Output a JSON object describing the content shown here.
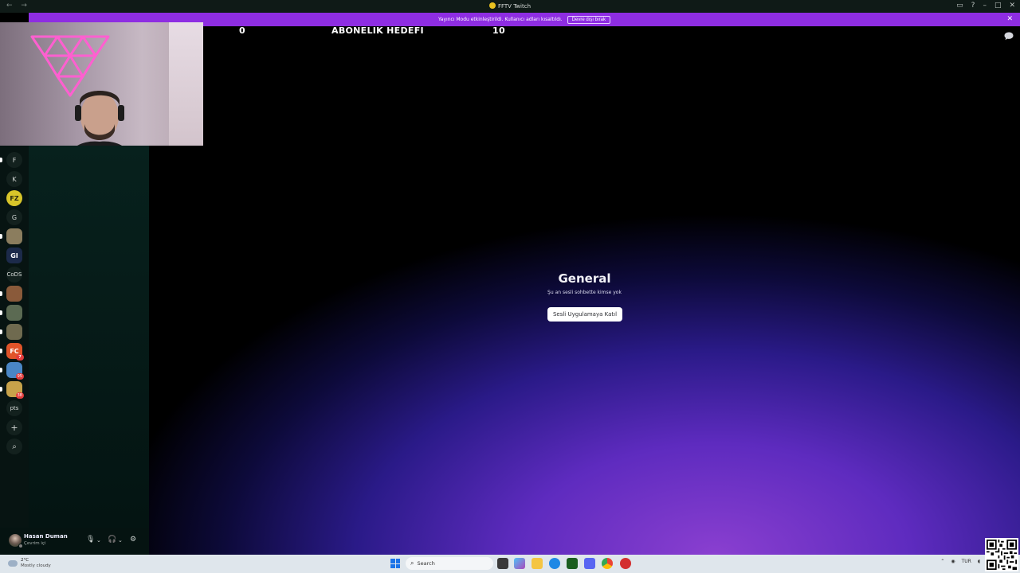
{
  "window": {
    "title": "FFTV Twitch",
    "nav": "← →"
  },
  "banner": {
    "message": "Yayıncı Modu etkinleştirildi. Kullanıcı adları kısaltıldı.",
    "button_label": "Devre dışı bırak",
    "close": "✕"
  },
  "overlay": {
    "left_count": "0",
    "goal_label": "ABONELIK HEDEFI",
    "right_count": "10"
  },
  "servers": [
    {
      "label": "F",
      "type": "text",
      "pip": true
    },
    {
      "label": "K",
      "type": "text",
      "pip": false
    },
    {
      "label": "FZ",
      "type": "logo",
      "color": "#d8c52a",
      "pip": false
    },
    {
      "label": "G",
      "type": "text",
      "pip": false
    },
    {
      "label": "",
      "type": "img",
      "color": "#8b7d5e",
      "pip": true
    },
    {
      "label": "GI",
      "type": "logo",
      "color": "#1c2a4a",
      "pip": false
    },
    {
      "label": "CoDS",
      "type": "text",
      "pip": false
    },
    {
      "label": "",
      "type": "img",
      "color": "#8a5a3a",
      "pip": true
    },
    {
      "label": "",
      "type": "img",
      "color": "#5b6a52",
      "pip": true
    },
    {
      "label": "",
      "type": "img",
      "color": "#6f6a4f",
      "pip": true
    },
    {
      "label": "FC",
      "type": "logo",
      "color": "#e0542a",
      "badge": "7",
      "pip": true
    },
    {
      "label": "",
      "type": "img",
      "color": "#4a86c5",
      "badge": "95",
      "pip": true
    },
    {
      "label": "",
      "type": "img",
      "color": "#c7a24a",
      "badge": "38",
      "pip": true
    },
    {
      "label": "pts",
      "type": "text",
      "pip": false
    },
    {
      "label": "+",
      "type": "action",
      "pip": false
    },
    {
      "label": "⌕",
      "type": "action",
      "pip": false
    }
  ],
  "user": {
    "name": "Hasan Duman",
    "status": "Çevrim içi"
  },
  "voice": {
    "channel_name": "General",
    "empty_text": "Şu an sesli sohbette kimse yok",
    "join_label": "Sesli Uygulamaya Katıl"
  },
  "taskbar": {
    "temperature": "2°C",
    "weather": "Mostly cloudy",
    "search_label": "Search",
    "language": "TUR"
  },
  "colors": {
    "banner": "#8e2de2",
    "rail_bg": "#071412",
    "taskbar_bg": "#dfe6ec"
  }
}
